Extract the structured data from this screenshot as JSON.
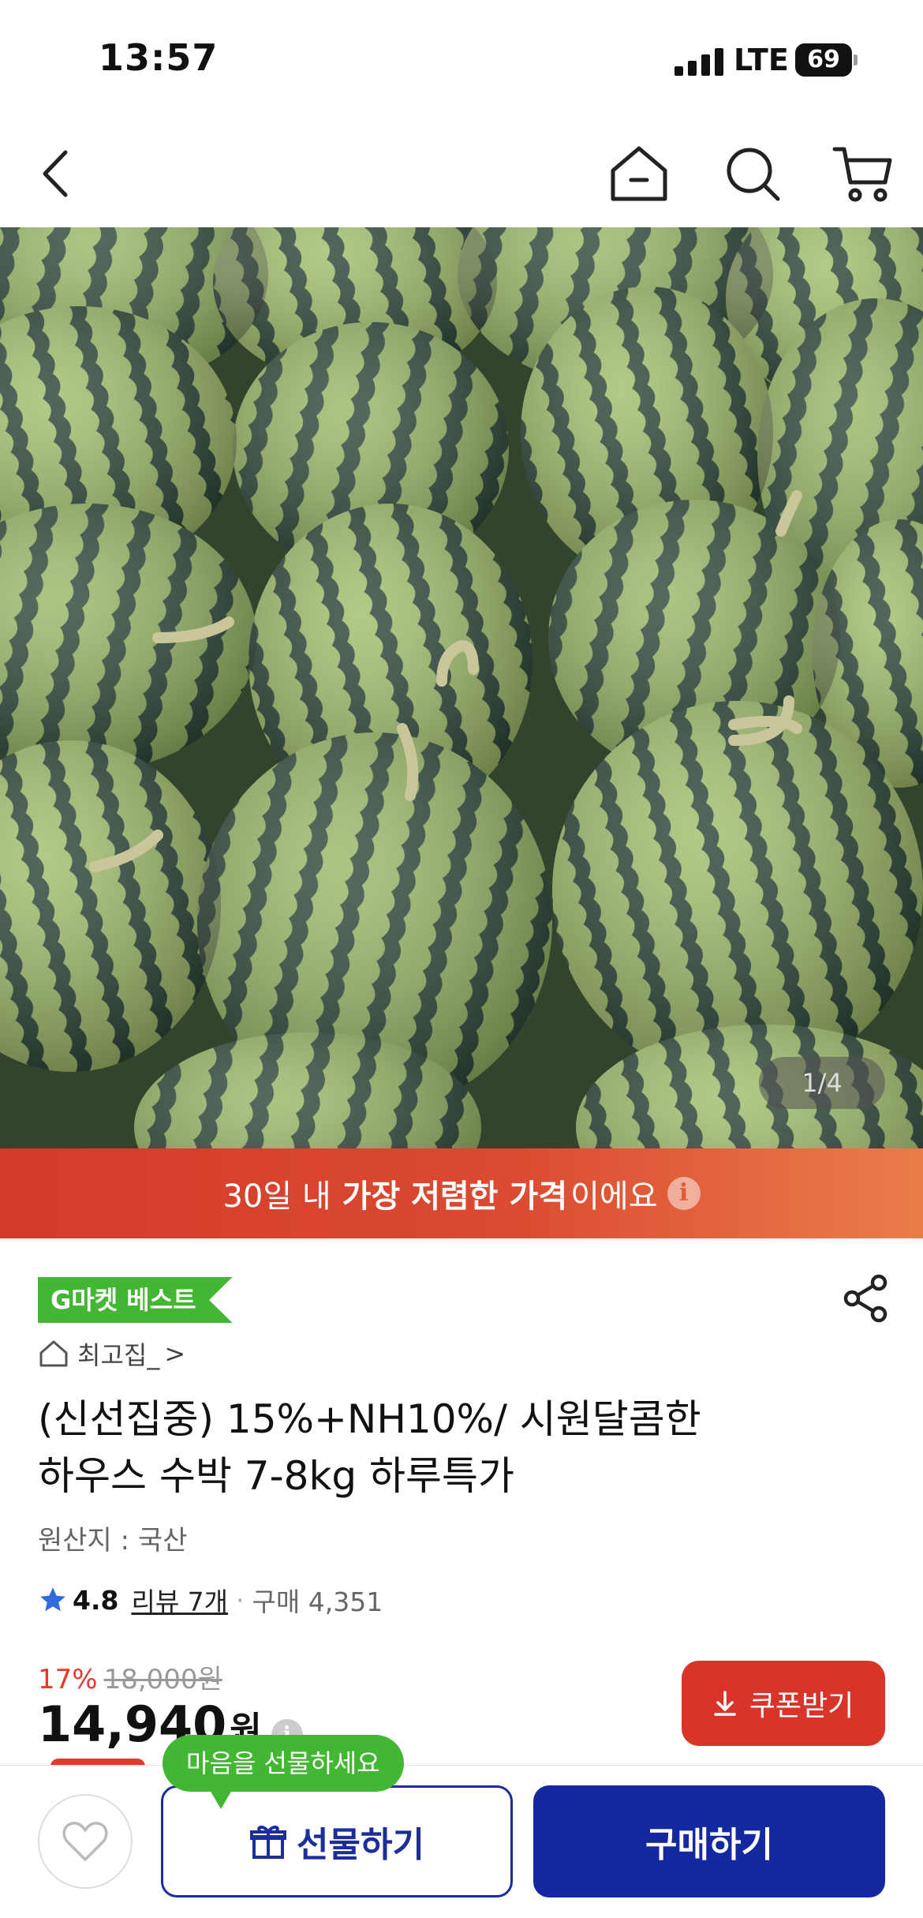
{
  "status_bar": {
    "time": "13:57",
    "network": "LTE",
    "battery": "69"
  },
  "nav": {
    "icons": [
      "back-arrow-icon",
      "home-icon",
      "search-icon",
      "cart-icon"
    ]
  },
  "hero": {
    "page_indicator": "1/4"
  },
  "banner": {
    "pre": "30일 내",
    "strong": "가장 저렴한 가격",
    "post": "이에요",
    "info_glyph": "i"
  },
  "product": {
    "badge": "G마켓 베스트",
    "store_name": "최고집_",
    "store_chevron": ">",
    "title_line1": "(신선집중) 15%+NH10%/ 시원달콤한",
    "title_line2": "하우스 수박 7-8kg 하루특가",
    "origin": "원산지 : 국산",
    "rating": "4.8",
    "review_label": "리뷰 7개",
    "separator": "·",
    "purchase_label": "구매 4,351",
    "discount_rate": "17%",
    "original_price": "18,000원",
    "sale_price": "14,940",
    "currency": "원",
    "price_info_glyph": "i",
    "coupon_label": "쿠폰받기"
  },
  "bottom": {
    "tooltip": "마음을 선물하세요",
    "gift_label": "선물하기",
    "buy_label": "구매하기"
  },
  "colors": {
    "accent_red": "#d9342a",
    "badge_green": "#43b633",
    "primary_blue": "#1428a0"
  }
}
